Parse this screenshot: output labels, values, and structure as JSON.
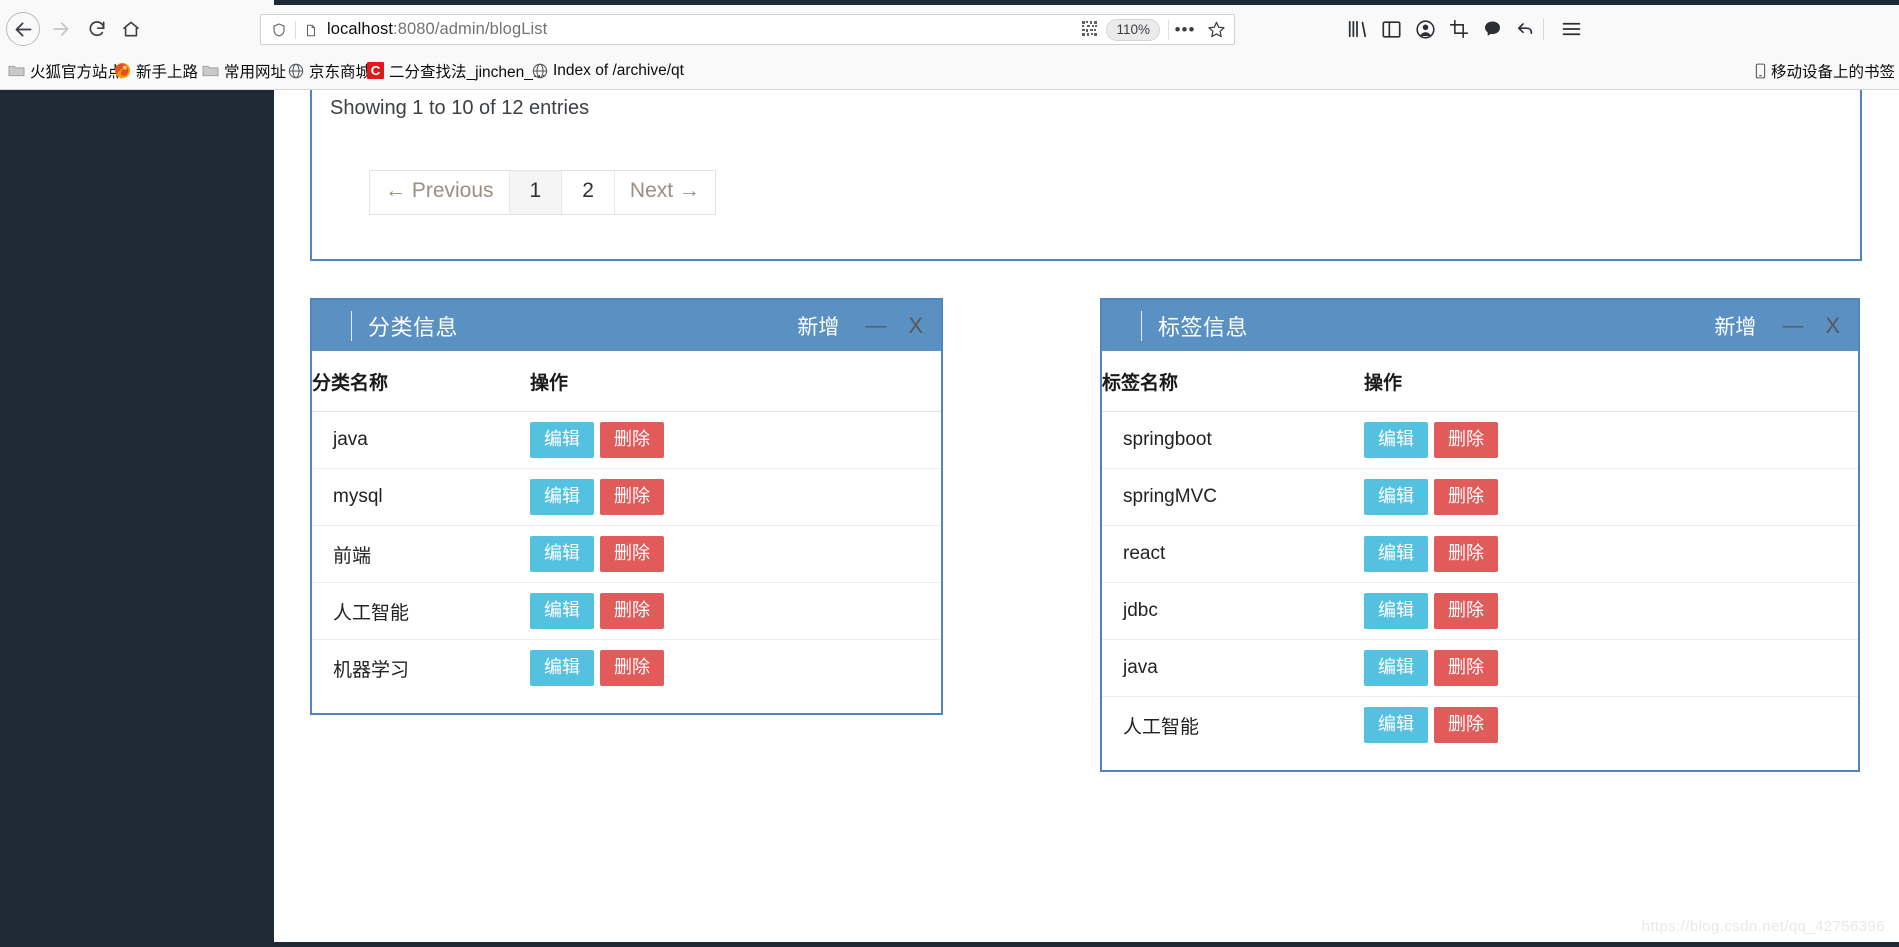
{
  "browser": {
    "nav": {
      "back_icon": "arrow-left-icon",
      "forward_icon": "arrow-right-icon",
      "reload_icon": "reload-icon",
      "home_icon": "home-icon"
    },
    "urlbar": {
      "shield_icon": "shield-icon",
      "page_icon": "page-icon",
      "url_host": "localhost",
      "url_path": ":8080/admin/blogList",
      "url_full": "localhost:8080/admin/blogList",
      "qr_icon": "qr-code-icon",
      "zoom_level": "110%",
      "more_label": "•••",
      "bookmark_icon": "star-icon"
    },
    "toolbar_icons": [
      {
        "name": "library-icon",
        "glyph": "‖∖"
      },
      {
        "name": "sidebar-icon",
        "glyph": "▤"
      },
      {
        "name": "account-icon",
        "glyph": "ⓧ"
      },
      {
        "name": "screenshot-icon",
        "glyph": "⛶"
      },
      {
        "name": "pocket-icon",
        "glyph": "὞9"
      },
      {
        "name": "undo-icon",
        "glyph": "↩"
      },
      {
        "name": "menu-icon",
        "glyph": "☰"
      }
    ],
    "bookmarks": [
      {
        "label": "火狐官方站点",
        "icon": "folder-icon"
      },
      {
        "label": "新手上路",
        "icon": "firefox-icon"
      },
      {
        "label": "常用网址",
        "icon": "folder-icon"
      },
      {
        "label": "京东商城",
        "icon": "globe-icon"
      },
      {
        "label": "二分查找法_jinchen_...",
        "icon": "csdn-icon"
      },
      {
        "label": "Index of /archive/qt",
        "icon": "globe-icon"
      }
    ],
    "mobile_bookmarks": {
      "label": "移动设备上的书签",
      "icon": "mobile-icon"
    }
  },
  "bloglist": {
    "entries_info": "Showing 1 to 10 of 12 entries",
    "pagination": [
      {
        "label": "← Previous",
        "type": "prev",
        "active": false
      },
      {
        "label": "1",
        "type": "num",
        "active": true
      },
      {
        "label": "2",
        "type": "num",
        "active": false
      },
      {
        "label": "Next →",
        "type": "next",
        "active": false
      }
    ]
  },
  "category_card": {
    "title": "分类信息",
    "add_label": "新增",
    "minimize_label": "—",
    "close_label": "X",
    "columns": [
      "分类名称",
      "操作"
    ],
    "edit_label": "编辑",
    "delete_label": "删除",
    "rows": [
      {
        "name": "java"
      },
      {
        "name": "mysql"
      },
      {
        "name": "前端"
      },
      {
        "name": "人工智能"
      },
      {
        "name": "机器学习"
      }
    ]
  },
  "tag_card": {
    "title": "标签信息",
    "add_label": "新增",
    "minimize_label": "—",
    "close_label": "X",
    "columns": [
      "标签名称",
      "操作"
    ],
    "edit_label": "编辑",
    "delete_label": "删除",
    "rows": [
      {
        "name": "springboot"
      },
      {
        "name": "springMVC"
      },
      {
        "name": "react"
      },
      {
        "name": "jdbc"
      },
      {
        "name": "java"
      },
      {
        "name": "人工智能"
      }
    ]
  },
  "watermark": "https://blog.csdn.net/qq_42756396",
  "colors": {
    "panel_border": "#4f86bd",
    "card_header": "#5b90c2",
    "edit_button": "#55c1e0",
    "delete_button": "#e15b5b",
    "sidebar": "#1d2935"
  }
}
